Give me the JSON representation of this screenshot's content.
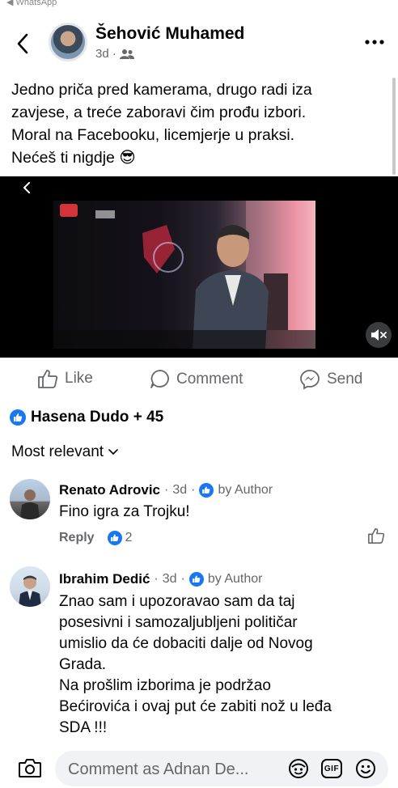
{
  "status": {
    "app_label": "◀ WhatsApp"
  },
  "header": {
    "author": "Šehović Muhamed",
    "time": "3d",
    "audience_icon": "friends-icon",
    "more_icon": "more-dots-icon",
    "back_icon": "back-chevron-icon"
  },
  "post": {
    "lines": [
      "Jedno priča pred kamerama, drugo radi iza",
      "zavjese, a treće zaboravi čim prođu izbori.",
      "Moral na Facebooku, licemjerje u praksi.",
      "Nećeš ti nigdje 😎"
    ]
  },
  "video": {
    "mute_icon": "muted-speaker-icon",
    "back_icon": "video-back-icon"
  },
  "actions": {
    "like": "Like",
    "comment": "Comment",
    "send": "Send"
  },
  "reactions": {
    "summary": "Hasena Dudo + 45"
  },
  "sort": {
    "label": "Most relevant"
  },
  "comments": [
    {
      "author": "Renato Adrovic",
      "time": "3d",
      "badge": "by Author",
      "text": [
        "Fino igra za Trojku!"
      ],
      "reply": "Reply",
      "likes": "2"
    },
    {
      "author": "Ibrahim Dedić",
      "time": "3d",
      "badge": "by Author",
      "text": [
        "Znao sam i upozoravao sam da taj",
        "posesivni i samozaljubljeni političar",
        "umislio da će dobaciti dalje od Novog",
        "Grada.",
        "Na prošlim izborima je podržao",
        "Bećirovića i ovaj put će zabiti nož u leđa",
        "SDA !!!"
      ]
    }
  ],
  "composer": {
    "placeholder": "Comment as Adnan De...",
    "gif_label": "GIF"
  },
  "colors": {
    "accent": "#1877f2",
    "secondary_text": "#65676b",
    "input_bg": "#f0f2f5"
  }
}
